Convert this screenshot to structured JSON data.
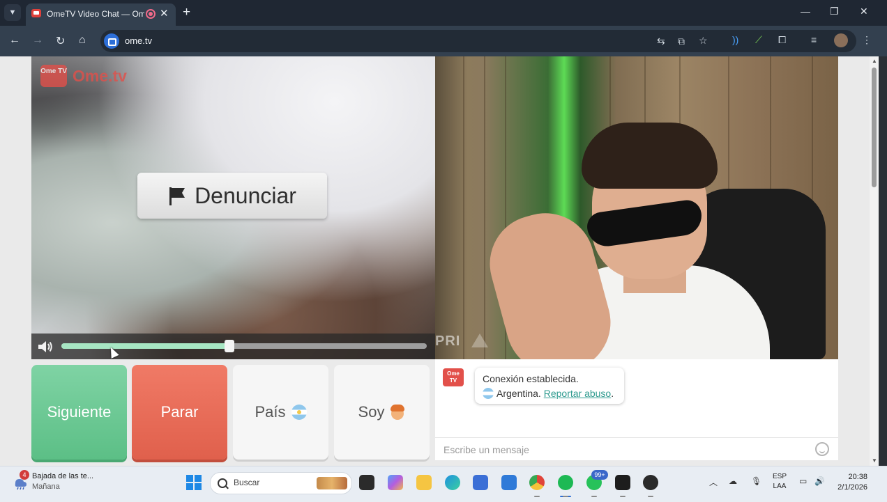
{
  "browser": {
    "tab_title": "OmeTV Video Chat — Ome",
    "url": "ome.tv",
    "new_tab": "+",
    "tab_close": "✕",
    "window_minimize": "—",
    "window_restore": "❐",
    "window_close": "✕"
  },
  "video": {
    "logo_box": "Ome TV",
    "logo_text": "Ome.tv",
    "report_button": "Denunciar",
    "volume_level": 0.46,
    "watermark": "PRI"
  },
  "buttons": {
    "next": "Siguiente",
    "stop": "Parar",
    "country": "País",
    "gender": "Soy"
  },
  "chat": {
    "logo": "Ome TV",
    "status": "Conexión establecida.",
    "country": "Argentina.",
    "report_link": "Reportar abuso",
    "report_link_suffix": ".",
    "input_placeholder": "Escribe un mensaje"
  },
  "taskbar": {
    "weather_badge": "4",
    "weather_title": "Bajada de las te...",
    "weather_sub": "Mañana",
    "search_placeholder": "Buscar",
    "whatsapp_badge": "99+",
    "lang_top": "ESP",
    "lang_bottom": "LAA",
    "time": "20:38",
    "date": "2/1/2026"
  },
  "colors": {
    "next_button": "#6fca96",
    "stop_button": "#e76c58",
    "accent_green": "#a7e6c3",
    "link": "#2f9b8f"
  }
}
